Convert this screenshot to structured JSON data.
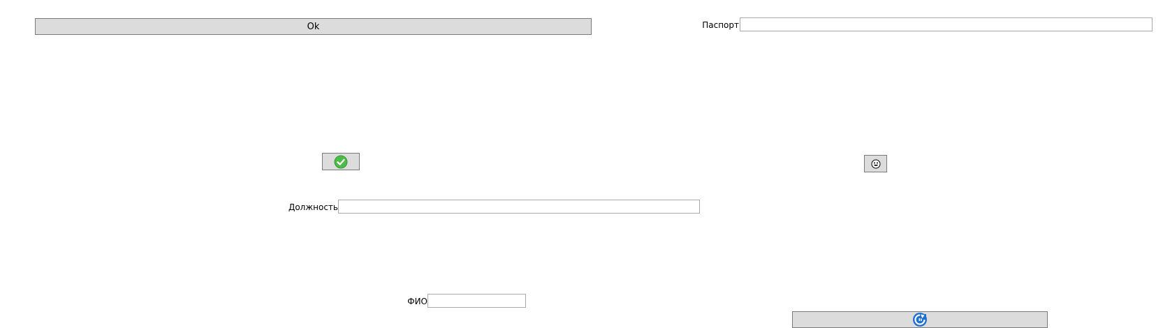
{
  "ok_button": {
    "label": "Ok"
  },
  "passport": {
    "label": "Паспорт",
    "value": "",
    "placeholder": ""
  },
  "position": {
    "label": "Должность",
    "value": "",
    "placeholder": ""
  },
  "fio": {
    "label": "ФИО",
    "value": "",
    "placeholder": ""
  },
  "icons": {
    "confirm": "check-circle-icon",
    "emoji": "smiley-icon",
    "refresh": "refresh-icon"
  },
  "colors": {
    "button_bg": "#dcdcdc",
    "button_border": "#7a7a7a",
    "field_border": "#a9a9a9",
    "check_green": "#4cbb48",
    "refresh_blue": "#1f6fd1"
  }
}
